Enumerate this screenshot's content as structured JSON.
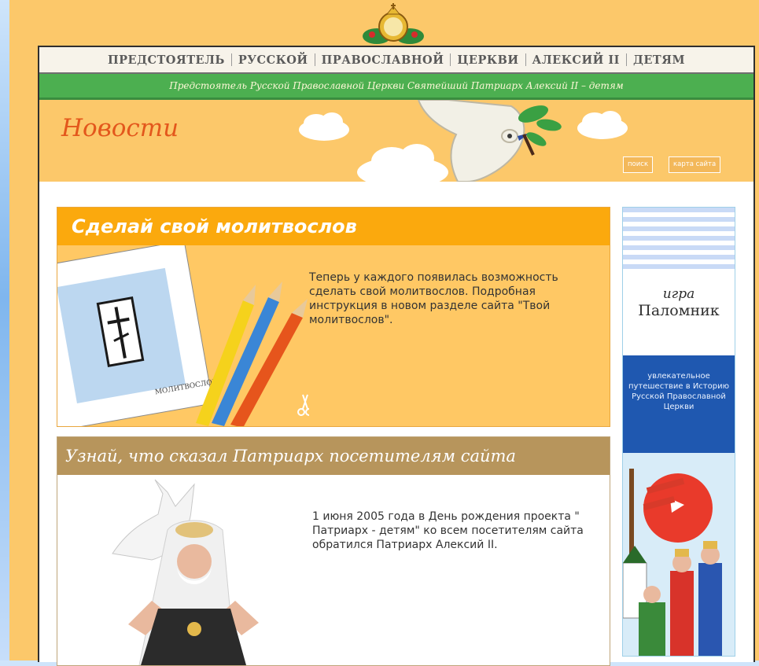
{
  "nav": {
    "items": [
      "ПРЕДСТОЯТЕЛЬ",
      "РУССКОЙ",
      "ПРАВОСЛАВНОЙ",
      "ЦЕРКВИ",
      "АЛЕКСИЙ II",
      "ДЕТЯМ"
    ]
  },
  "subtitle": "Предстоятель Русской Православной Церкви Святейший Патриарх Алексий II – детям",
  "banner": {
    "title": "Новости",
    "search_label": "поиск",
    "sitemap_label": "карта сайта"
  },
  "card1": {
    "title": "Сделай свой молитвослов",
    "text": "Теперь у каждого появилась возможность сделать свой молитвослов. Подробная инструкция в новом разделе сайта \"Твой молитвослов\".",
    "image_caption": "МОЛИТВОСЛОВ"
  },
  "card2": {
    "title": "Узнай, что сказал Патриарх посетителям сайта",
    "text": "1 июня 2005 года в День рождения проекта \" Патриарх - детям\" ко всем посетителям сайта обратился Патриарх Алексий II."
  },
  "sidebar": {
    "game_word": "игра",
    "game_name": "Паломник",
    "description": "увлекательное путешествие в Историю Русской Православной Церкви"
  },
  "colors": {
    "page_orange": "#fcc86a",
    "green_bar": "#4caf50",
    "card1_header": "#fba90d",
    "card2_header": "#b7955c",
    "news_title": "#e3571c",
    "sidebar_blue": "#1f58b0"
  }
}
